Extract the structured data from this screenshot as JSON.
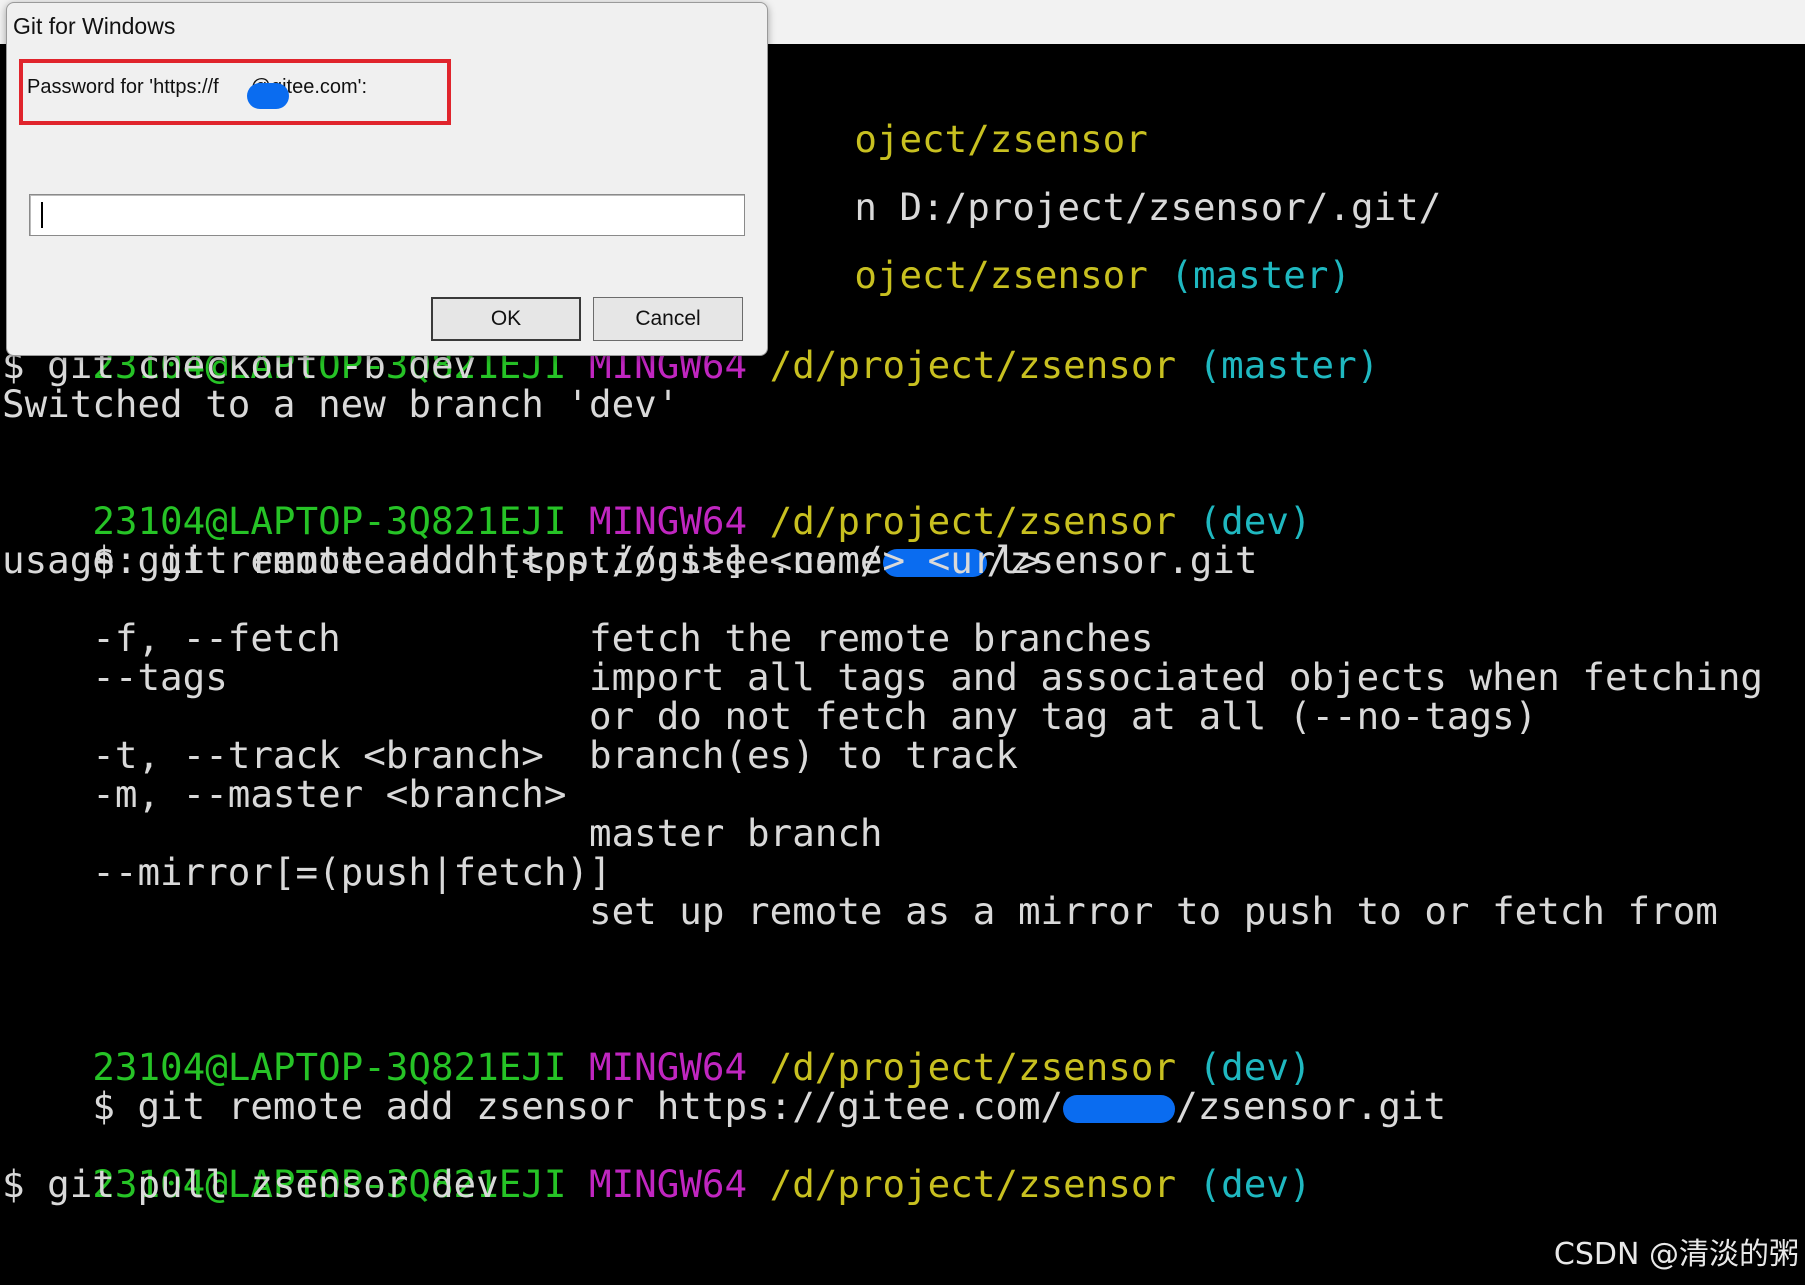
{
  "dialog": {
    "title": "Git for Windows",
    "prompt_prefix": "Password for 'https://f",
    "prompt_suffix": "@gitee.com':",
    "input_value": "",
    "ok_label": "OK",
    "cancel_label": "Cancel"
  },
  "terminal": {
    "partial_lines": [
      {
        "text": "oject/zsensor",
        "color": "path"
      },
      {
        "text": "n D:/project/zsensor/.git/",
        "color": "text"
      },
      {
        "text": "oject/zsensor",
        "color": "path",
        "branch": "(master)"
      }
    ],
    "prompt_user": "23104@LAPTOP-3Q821EJI",
    "prompt_env": "MINGW64",
    "prompt_path": "/d/project/zsensor",
    "blocks": [
      {
        "branch": "(master)",
        "command": "$ git checkout -b dev",
        "output": [
          "Switched to a new branch 'dev'"
        ]
      },
      {
        "branch": "(dev)",
        "command_prefix": "$ git remote add https://gitee.com/",
        "command_suffix": "/zsensor.git",
        "output": [
          "usage: git remote add [<options>] <name> <url>",
          "",
          "    -f, --fetch           fetch the remote branches",
          "    --tags                import all tags and associated objects when fetching",
          "                          or do not fetch any tag at all (--no-tags)",
          "    -t, --track <branch>  branch(es) to track",
          "    -m, --master <branch>",
          "                          master branch",
          "    --mirror[=(push|fetch)]",
          "                          set up remote as a mirror to push to or fetch from"
        ]
      },
      {
        "branch": "(dev)",
        "command_prefix": "$ git remote add zsensor https://gitee.com/",
        "command_suffix": "/zsensor.git"
      },
      {
        "branch": "(dev)",
        "command": "$ git pull zsensor dev"
      }
    ]
  },
  "watermark": "CSDN @清淡的粥",
  "colors": {
    "user": "#26c326",
    "mingw": "#c026c0",
    "path": "#c8c020",
    "branch": "#1fb8c0",
    "text": "#d9d9d9",
    "highlight_border": "#e0242c",
    "redaction": "#0a6cf0"
  }
}
